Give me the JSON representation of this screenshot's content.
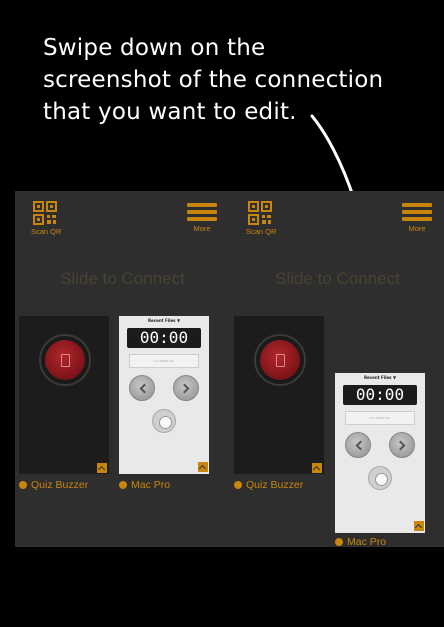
{
  "instruction": {
    "line1": "Swipe down on the",
    "line2": "screenshot of the connection",
    "line3": "that you want to edit."
  },
  "panels": [
    {
      "scan_label": "Scan QR",
      "more_label": "More",
      "slide_text": "Slide to Connect",
      "connection1_label": "Quiz Buzzer",
      "connection2_label": "Mac Pro",
      "screenshot": {
        "recent_files": "Recent Files ▼",
        "timer": "00:00",
        "field": "not SWIPE bar"
      }
    },
    {
      "scan_label": "Scan QR",
      "more_label": "More",
      "slide_text": "Slide to Connect",
      "connection1_label": "Quiz Buzzer",
      "connection2_label": "Mac Pro",
      "screenshot": {
        "recent_files": "Recent Files ▼",
        "timer": "00:00",
        "field": "not SWIPE bar"
      }
    }
  ],
  "colors": {
    "accent": "#c8860d",
    "panel_bg": "#2e2e2e",
    "buzzer": "#9a1c22",
    "background": "#000000"
  },
  "icons": [
    "qr-code-icon",
    "hamburger-menu-icon",
    "chevron-up-icon",
    "connection-dot-icon",
    "arrow-down-icon"
  ]
}
